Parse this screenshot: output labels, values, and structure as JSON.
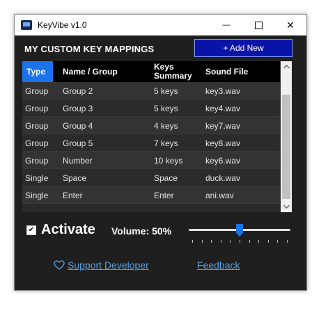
{
  "window": {
    "title": "KeyVibe v1.0",
    "minimize_glyph": "—",
    "close_glyph": "✕"
  },
  "header": {
    "title": "MY CUSTOM KEY MAPPINGS",
    "add_button_label": "+ Add New"
  },
  "table": {
    "columns": {
      "type": "Type",
      "name": "Name / Group",
      "keys_line1": "Keys",
      "keys_line2": "Summary",
      "sound": "Sound File"
    },
    "rows": [
      {
        "type": "Group",
        "name": "Group 2",
        "keys": "5 keys",
        "sound": "key3.wav"
      },
      {
        "type": "Group",
        "name": "Group 3",
        "keys": "5 keys",
        "sound": "key4.wav"
      },
      {
        "type": "Group",
        "name": "Group 4",
        "keys": "4 keys",
        "sound": "key7.wav"
      },
      {
        "type": "Group",
        "name": "Group 5",
        "keys": "7 keys",
        "sound": "key8.wav"
      },
      {
        "type": "Group",
        "name": "Number",
        "keys": "10 keys",
        "sound": "key6.wav"
      },
      {
        "type": "Single",
        "name": "Space",
        "keys": "Space",
        "sound": "duck.wav"
      },
      {
        "type": "Single",
        "name": "Enter",
        "keys": "Enter",
        "sound": "ani.wav"
      }
    ]
  },
  "controls": {
    "activate_label": "Activate",
    "activate_checked": true,
    "check_glyph": "✔",
    "volume_label": "Volume: 50%",
    "volume_value": 50
  },
  "links": {
    "support_label": "Support Developer",
    "feedback_label": "Feedback"
  },
  "colors": {
    "accent": "#1a73e8",
    "add_button": "#0a14a8",
    "link": "#5aa0e0",
    "window_bg": "#1f1f1f"
  },
  "icons": {
    "app": "keyboard-app-icon",
    "support": "heart-icon",
    "scroll_up": "chevron-up-icon",
    "scroll_down": "chevron-down-icon"
  }
}
